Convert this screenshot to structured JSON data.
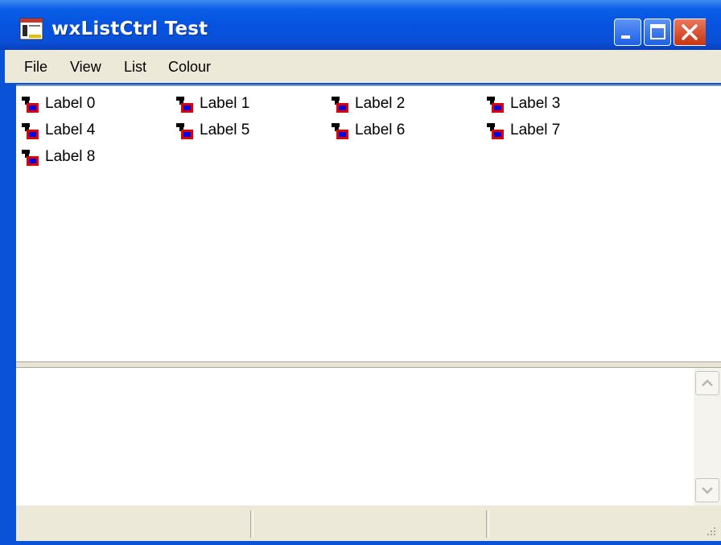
{
  "window": {
    "title": "wxListCtrl Test"
  },
  "menu": [
    "File",
    "View",
    "List",
    "Colour"
  ],
  "list": {
    "items": [
      "Label 0",
      "Label 1",
      "Label 2",
      "Label 3",
      "Label 4",
      "Label 5",
      "Label 6",
      "Label 7",
      "Label 8"
    ]
  },
  "icons": {
    "app": "application-icon",
    "item": "list-item-icon",
    "minimize": "minimize-icon",
    "maximize": "maximize-icon",
    "close": "close-icon",
    "scroll_up": "scroll-up-arrow-icon",
    "scroll_down": "scroll-down-arrow-icon",
    "grip": "resize-grip-icon"
  },
  "colors": {
    "titlebar": "#0553e0",
    "menubar": "#ece9d8",
    "close_button": "#c93410"
  }
}
